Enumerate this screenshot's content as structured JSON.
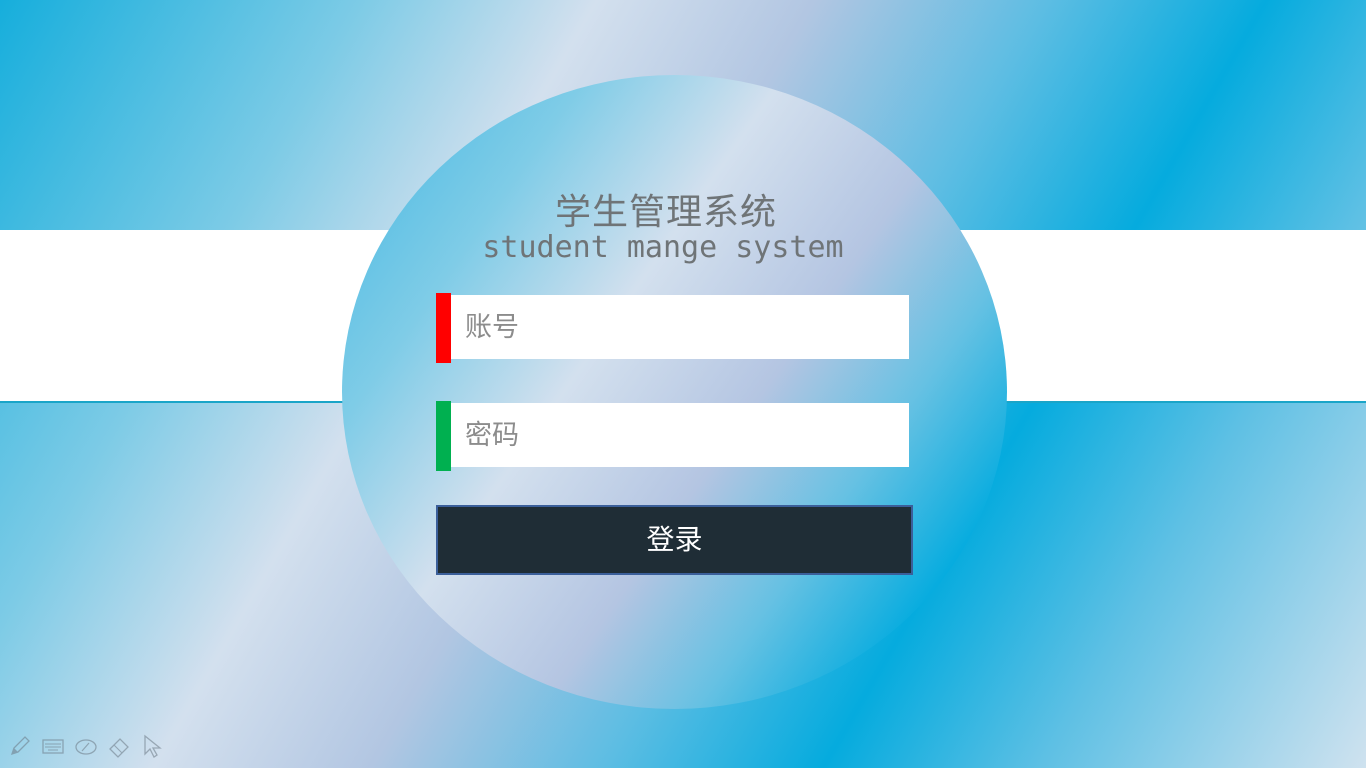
{
  "app": {
    "title_cn": "学生管理系统",
    "title_en": "student mange system"
  },
  "login_form": {
    "username": {
      "placeholder": "账号",
      "value": "",
      "accent_color": "#ff0000"
    },
    "password": {
      "placeholder": "密码",
      "value": "",
      "accent_color": "#00b050"
    },
    "submit_label": "登录"
  },
  "toolbar": {
    "icons": [
      "pen-icon",
      "keyboard-icon",
      "eraser-oval-icon",
      "eraser-icon",
      "pointer-icon"
    ]
  },
  "colors": {
    "button_bg": "#1f2d36",
    "button_border": "#3b5f9a",
    "title_text": "#6f7477"
  }
}
